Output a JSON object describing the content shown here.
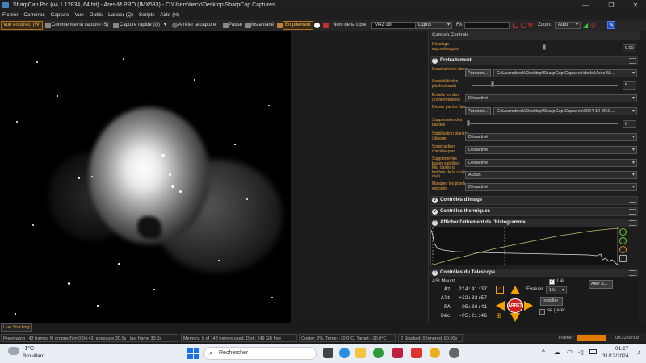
{
  "window": {
    "title": "SharpCap Pro (v4.1.12834, 64 bit) - Ares-M PRO (IMX533) - C:\\Users\\beck\\Desktop\\SharpCap Captures",
    "minimize": "—",
    "maximize": "❐",
    "close": "✕"
  },
  "menu": [
    "Fichier",
    "Caméras",
    "Capture",
    "Vue",
    "Outils",
    "Lancer (Q)",
    "Scripts",
    "Aide (H)"
  ],
  "toolbar": {
    "live_view": "Vue en direct (W)",
    "start_capture": "Commencer la capture (S)",
    "quick_capture": "Capture rapide (Q)",
    "stop_capture": "Arrêter la capture",
    "pause": "Pause",
    "snapshot": "Instantané",
    "stacking": "Empilement",
    "target_label": "Nom de la cible:",
    "target_value": "M42 oiii",
    "frame_type": "Lights",
    "fx_label": "FX",
    "zoom_label": "Zoom:",
    "zoom_value": "Auto"
  },
  "panel": {
    "header": "Camera Controls",
    "offset_label": "Décalage exposition/gain",
    "offset_value": "0.00",
    "preprocessing": {
      "title": "Prétraitement",
      "subtract_darks_label": "Soustraire les darks",
      "browse": "Parcouri...",
      "darks_path": "C:\\Users\\beck\\Desktop\\SharpCap Captures\\darks\\Ares-M...",
      "hot_pixel_label": "Sensibilité des pixels chauds",
      "hot_pixel_value": "5",
      "dark_scale_label": "Échelle sombre (expérimentale)",
      "dark_scale_value": "Désactivé",
      "flats_label": "Diviser par les flats",
      "flats_path": "C:\\Users\\beck\\Desktop\\SharpCap Captures\\2024-12-30\\C...",
      "banding_label": "Suppression des bandes",
      "banding_value": "0",
      "stabilization_label": "Stabilisation planète / disque",
      "stabilization_value": "Désactivé",
      "background_label": "Soustraction d'arrière-plan",
      "background_value": "Désactivé",
      "satellite_label": "Supprimer les traces satellites",
      "satellite_value": "Désactivé",
      "flip_label": "Flip (après la tombée de la scalée réel)",
      "flip_value": "Aucun",
      "mask_label": "Masquer les pixels exposés",
      "mask_value": "Désactivé"
    },
    "image_controls": "Contrôles d'image",
    "thermal_controls": "Contrôles thermiques",
    "histogram": "Afficher l'étirement de l'histogramme",
    "telescope": {
      "title": "Contrôles du Télescope",
      "mount": "ASI Mount",
      "az_label": "Az",
      "az_value": "214:41:37",
      "alt_label": "Alt",
      "alt_value": "+32:32:57",
      "ra_label": "RA",
      "ra_value": "05:36:41",
      "dec_label": "Déc",
      "dec_value": "-05:21:46",
      "linked": "Lié",
      "goto": "Aller à...",
      "rate_label": "Évaluer",
      "rate_value": "16x",
      "install": "Installer",
      "park": "se garer",
      "stop": "ARRÊT"
    }
  },
  "status": {
    "tab": "Live Stacking",
    "preview": "Previewing : 43 frames (0 dropped) in 0:04:43, exposure 30,0s , last frame 30,0s",
    "memory": "Memory: 5 of 148 frames used, Disk: 249 GB free",
    "cooler": "Cooler: 2%, Temp: -10,0°C, Target: -10,0°C",
    "stacked": "2 Stacked, 0 Ignored, 60,00s",
    "frame_label": "Frame :",
    "frame_count": "00:22/00:08"
  },
  "taskbar": {
    "weather_temp": "-1°C",
    "weather_desc": "Brouillard",
    "search": "Rechercher",
    "time": "01:27",
    "date": "31/12/2024"
  },
  "colors": {
    "accent": "#e8a040",
    "stop": "#d02020",
    "arrow": "#f5a000"
  }
}
